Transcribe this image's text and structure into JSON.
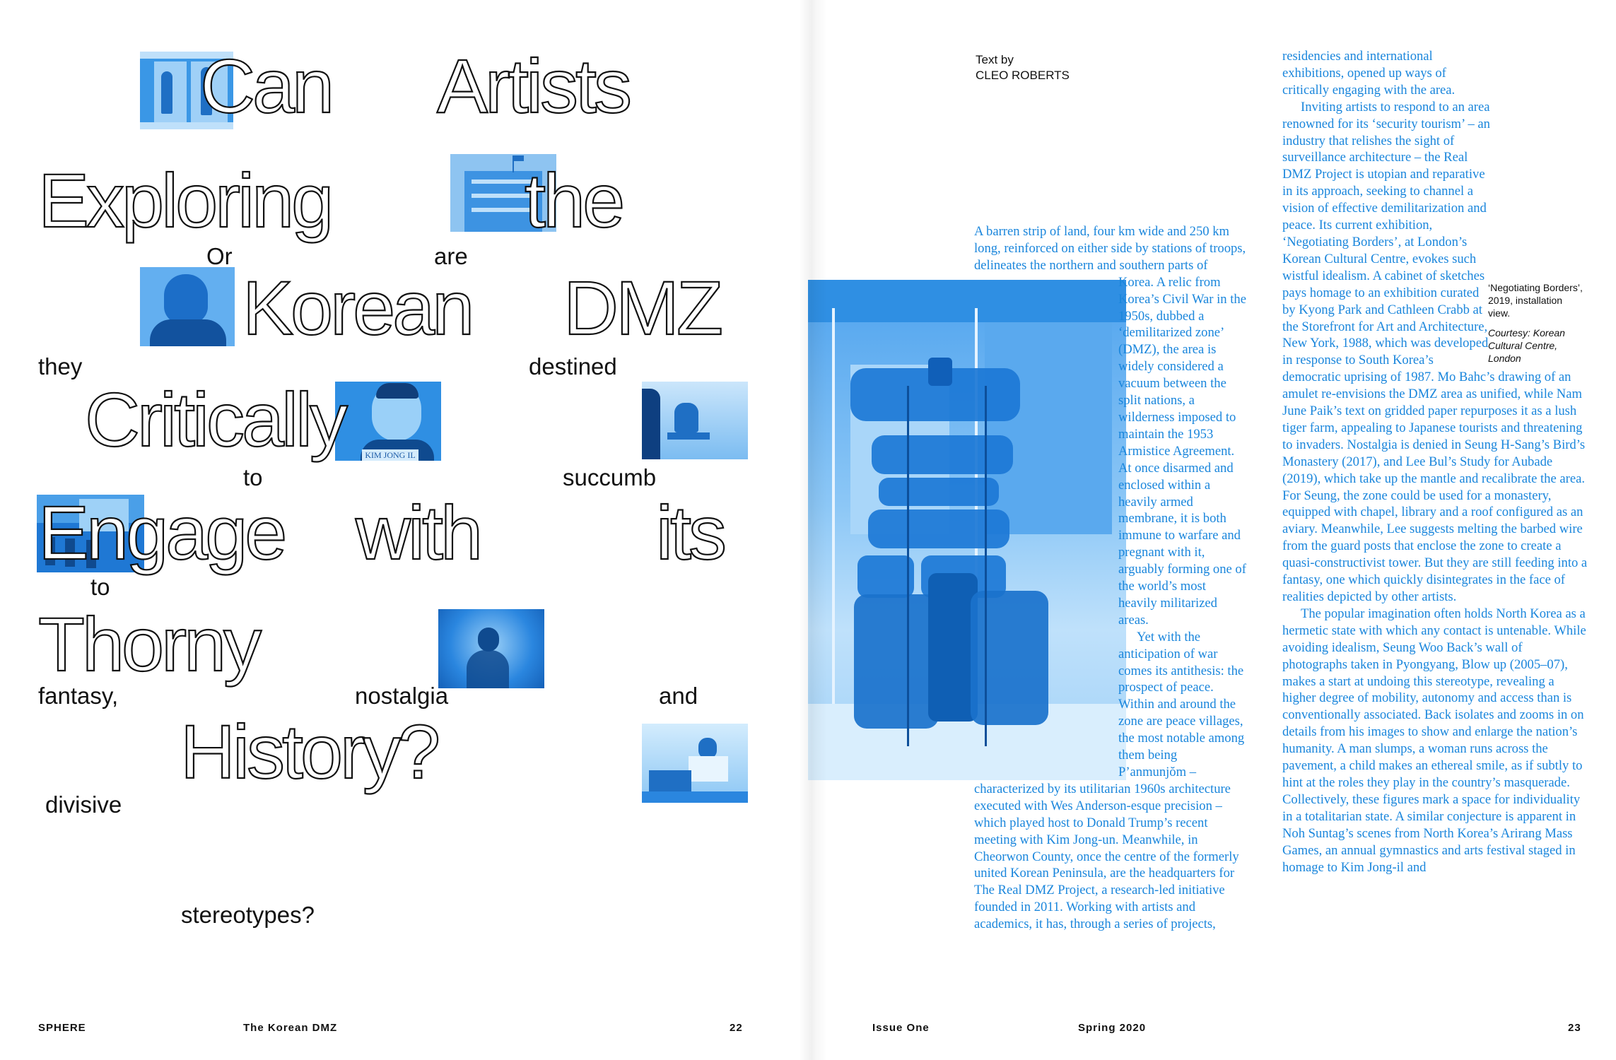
{
  "spread": {
    "left_page": {
      "headline_words": [
        {
          "id": "can",
          "text": "Can"
        },
        {
          "id": "artists",
          "text": "Artists"
        },
        {
          "id": "exploring",
          "text": "Exploring"
        },
        {
          "id": "the",
          "text": "the"
        },
        {
          "id": "korean",
          "text": "Korean"
        },
        {
          "id": "dmz",
          "text": "DMZ"
        },
        {
          "id": "critically",
          "text": "Critically"
        },
        {
          "id": "engage",
          "text": "Engage"
        },
        {
          "id": "with",
          "text": "with"
        },
        {
          "id": "its",
          "text": "its"
        },
        {
          "id": "thorny",
          "text": "Thorny"
        },
        {
          "id": "history",
          "text": "History?"
        }
      ],
      "scattered_words": [
        {
          "id": "or",
          "text": "Or"
        },
        {
          "id": "are",
          "text": "are"
        },
        {
          "id": "they",
          "text": "they"
        },
        {
          "id": "destined",
          "text": "destined"
        },
        {
          "id": "to-1",
          "text": "to"
        },
        {
          "id": "succumb",
          "text": "succumb"
        },
        {
          "id": "to-2",
          "text": "to"
        },
        {
          "id": "fantasy",
          "text": "fantasy,"
        },
        {
          "id": "nostalgia",
          "text": "nostalgia"
        },
        {
          "id": "and",
          "text": "and"
        },
        {
          "id": "divisive",
          "text": "divisive"
        },
        {
          "id": "stereotypes",
          "text": "stereotypes?"
        }
      ],
      "photo_caption_text": "KIM JONG IL",
      "folio": {
        "magazine": "SPHERE",
        "section": "The Korean DMZ",
        "page": "22"
      }
    },
    "right_page": {
      "byline_label": "Text by",
      "byline_author": "CLEO ROBERTS",
      "column_1": [
        "A barren strip of land, four km wide and 250 km long, reinforced on either side by stations of troops, delineates the northern and southern parts of Korea. A relic from Korea’s Civil War in the 1950s, dubbed a ‘demilitarized zone’ (DMZ), the area is widely considered a vacuum between the split nations, a wilderness imposed to maintain the 1953 Armistice Agreement. At once disarmed and enclosed within a heavily armed membrane, it is both immune to warfare and pregnant with it, arguably forming one of the world’s most heavily militarized areas.",
        "Yet with the anticipation of war comes its antithesis: the prospect of peace. Within and around the zone are peace villages, the most notable among them being P’anmunjŏm – characterized by its utilitarian 1960s architecture executed with Wes Anderson-esque precision – which played host to Donald Trump’s recent meeting with Kim Jong-un. Meanwhile, in Cheorwon County, once the centre of the formerly united Korean Peninsula, are the headquarters for The Real DMZ Project, a research-led initiative founded in 2011. Working with artists and academics, it has, through a series of projects,"
      ],
      "column_2": [
        "residencies and international exhibitions, opened up ways of critically engaging with the area.",
        "Inviting artists to respond to an area renowned for its ‘security tourism’ – an industry that relishes the sight of surveillance architecture – the Real DMZ Project is utopian and reparative in its approach, seeking to channel a vision of effective demilitarization and peace. Its current exhibition, ‘Negotiating Borders’, at London’s Korean Cultural Centre, evokes such wistful idealism. A cabinet of sketches pays homage to an exhibition curated by Kyong Park and Cathleen Crabb at the Storefront for Art and Architecture, New York, 1988, which was developed in response to South Korea’s democratic uprising of 1987. Mo Bahc’s drawing of an amulet re-envisions the DMZ area as unified, while Nam June Paik’s text on gridded paper repurposes it as a lush tiger farm, appealing to Japanese tourists and threatening to invaders. Nostalgia is denied in Seung H-Sang’s Bird’s Monastery (2017), and Lee Bul’s Study for Aubade (2019), which take up the mantle and recalibrate the area. For Seung, the zone could be used for a monastery, equipped with chapel, library and a roof configured as an aviary. Meanwhile, Lee suggests melting the barbed wire from the guard posts that enclose the zone to create a quasi-constructivist tower. But they are still feeding into a fantasy, one which quickly disintegrates in the face of realities depicted by other artists.",
        "The popular imagination often holds North Korea as a hermetic state with which any contact is untenable. While avoiding idealism, Seung Woo Back’s wall of photographs taken in Pyongyang, Blow up (2005–07), makes a start at undoing this stereotype, revealing a higher degree of mobility, autonomy and access than is conventionally associated. Back isolates and zooms in on details from his images to show and enlarge the nation’s humanity. A man slumps, a woman runs across the pavement, a child makes an ethereal smile, as if subtly to hint at the roles they play in the country’s masquerade. Collectively, these figures mark a space for individuality in a totalitarian state. A similar conjecture is apparent in Noh Suntag’s scenes from North Korea’s Arirang Mass Games, an annual gymnastics and arts festival staged in homage to Kim Jong-il and"
      ],
      "caption": {
        "title": "‘Negotiating Borders’, 2019, installation view.",
        "credit": "Courtesy: Korean Cultural Centre, London"
      },
      "folio": {
        "issue": "Issue One",
        "season": "Spring 2020",
        "page": "23"
      }
    }
  },
  "colors": {
    "accent_blue": "#1a86dc",
    "photo_blue": "#2e8fe3",
    "ink": "#111111",
    "paper": "#ffffff"
  }
}
